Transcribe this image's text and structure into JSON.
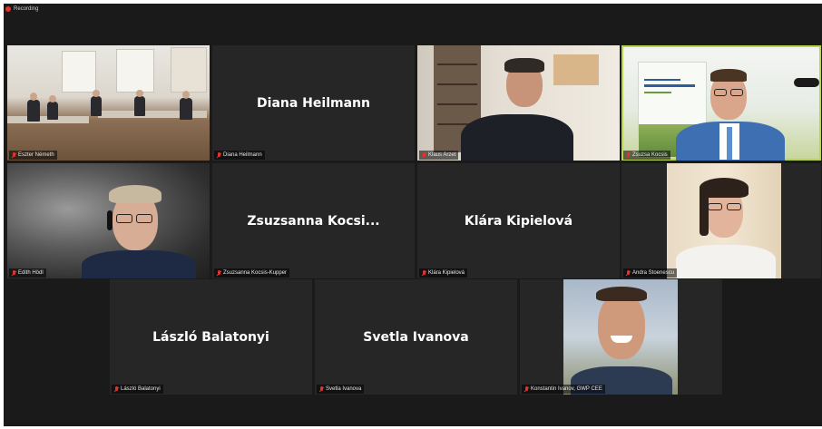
{
  "recording": {
    "label": "Recording"
  },
  "tiles": [
    {
      "id": "eszter",
      "name": "Eszter Németh",
      "display": "video"
    },
    {
      "id": "diana",
      "name": "Diana Heilmann",
      "big_name": "Diana Heilmann",
      "display": "name"
    },
    {
      "id": "klaus",
      "name": "Klaus Arzet",
      "display": "video"
    },
    {
      "id": "zsuzsa",
      "name": "Zsuzsa Kocsis",
      "display": "video",
      "active": true
    },
    {
      "id": "edith",
      "name": "Edith Hödl",
      "display": "video"
    },
    {
      "id": "zsuzsanna",
      "name": "Zsuzsanna Kocsis-Kupper",
      "big_name": "Zsuzsanna  Kocsi...",
      "display": "name"
    },
    {
      "id": "klara",
      "name": "Klára Kipielová",
      "big_name": "Klára Kipielová",
      "display": "name"
    },
    {
      "id": "andra",
      "name": "Andra Stoenescu",
      "display": "video"
    },
    {
      "id": "laszlo",
      "name": "László Balatonyi",
      "big_name": "László Balatonyi",
      "display": "name"
    },
    {
      "id": "svetla",
      "name": "Svetla Ivanova",
      "big_name": "Svetla Ivanova",
      "display": "name"
    },
    {
      "id": "konstantin",
      "name": "Konstantin Ivanov, GWP CEE",
      "display": "video"
    }
  ],
  "colors": {
    "muted_mic": "#e5322d",
    "active_speaker": "#b7d64a",
    "background": "#1a1a1a"
  },
  "icons": {
    "muted": "microphone-muted-icon",
    "recording": "recording-dot-icon"
  }
}
